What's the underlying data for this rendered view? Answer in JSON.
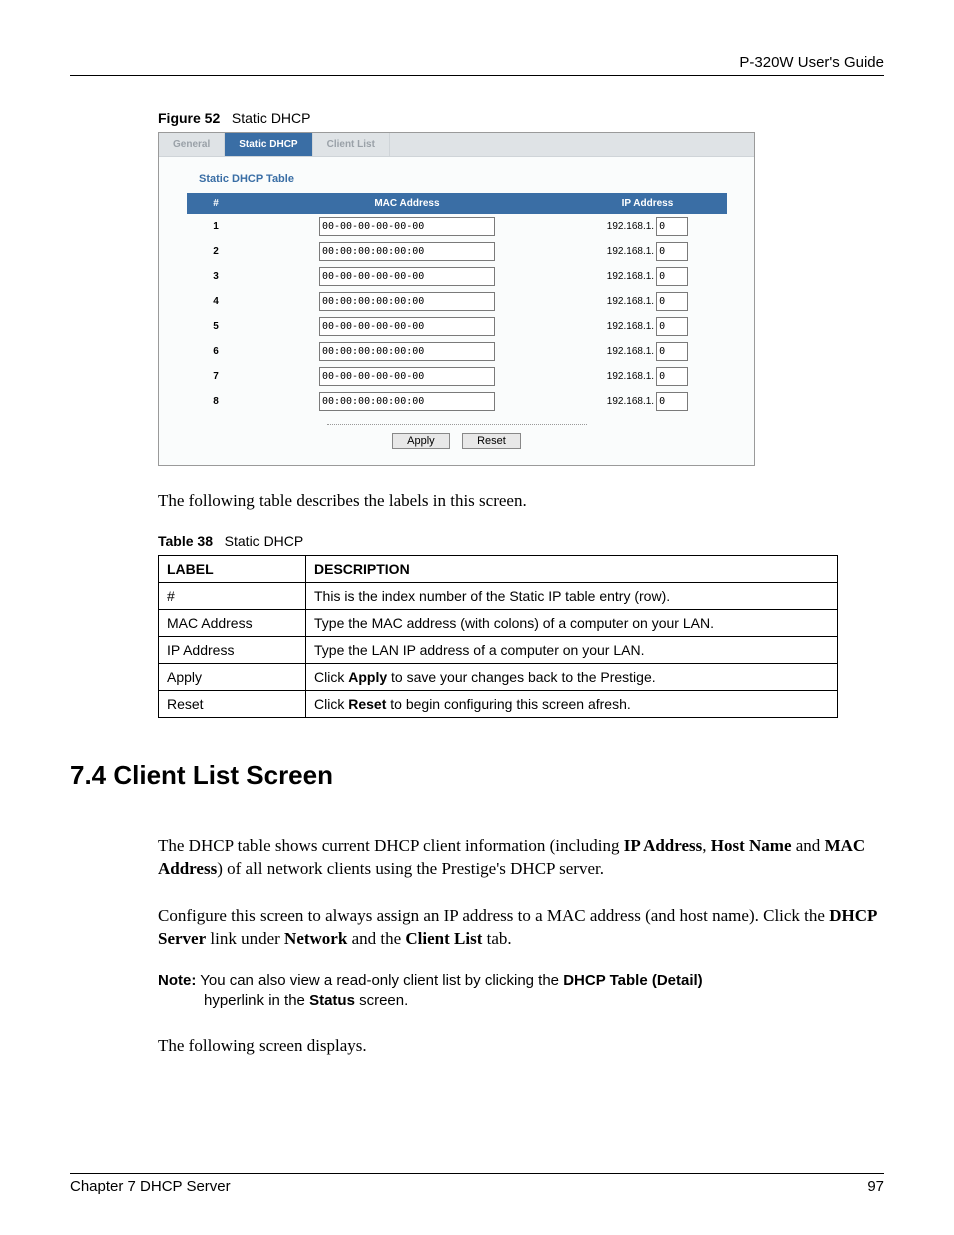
{
  "header": {
    "guide": "P-320W User's Guide"
  },
  "figure": {
    "label": "Figure 52",
    "title": "Static DHCP",
    "tabs": {
      "general": "General",
      "static_dhcp": "Static DHCP",
      "client_list": "Client List"
    },
    "section_title": "Static DHCP Table",
    "columns": {
      "num": "#",
      "mac": "MAC Address",
      "ip": "IP Address"
    },
    "ip_prefix": "192.168.1.",
    "rows": [
      {
        "n": "1",
        "mac": "00-00-00-00-00-00",
        "ip": "0"
      },
      {
        "n": "2",
        "mac": "00:00:00:00:00:00",
        "ip": "0"
      },
      {
        "n": "3",
        "mac": "00-00-00-00-00-00",
        "ip": "0"
      },
      {
        "n": "4",
        "mac": "00:00:00:00:00:00",
        "ip": "0"
      },
      {
        "n": "5",
        "mac": "00-00-00-00-00-00",
        "ip": "0"
      },
      {
        "n": "6",
        "mac": "00:00:00:00:00:00",
        "ip": "0"
      },
      {
        "n": "7",
        "mac": "00-00-00-00-00-00",
        "ip": "0"
      },
      {
        "n": "8",
        "mac": "00:00:00:00:00:00",
        "ip": "0"
      }
    ],
    "buttons": {
      "apply": "Apply",
      "reset": "Reset"
    }
  },
  "para1": "The following table describes the labels in this screen.",
  "table38": {
    "label": "Table 38",
    "title": "Static DHCP",
    "head": {
      "label": "LABEL",
      "desc": "DESCRIPTION"
    },
    "rows": [
      {
        "label": "#",
        "desc": "This is the index number of the Static IP table entry (row)."
      },
      {
        "label": "MAC Address",
        "desc": "Type the MAC address (with colons) of a computer on your LAN."
      },
      {
        "label": "IP Address",
        "desc": "Type the LAN IP address of a computer on your LAN."
      },
      {
        "label": "Apply",
        "desc_pre": "Click ",
        "desc_b": "Apply",
        "desc_post": " to save your changes back to the Prestige."
      },
      {
        "label": "Reset",
        "desc_pre": "Click ",
        "desc_b": "Reset",
        "desc_post": " to begin configuring this screen afresh."
      }
    ]
  },
  "section74": {
    "heading": "7.4  Client List Screen",
    "p1_a": "The DHCP table shows current DHCP client information (including ",
    "p1_b1": "IP Address",
    "p1_b": ", ",
    "p1_b2": "Host Name",
    "p1_c": " and ",
    "p1_b3": "MAC Address",
    "p1_d": ") of all network clients using the Prestige's DHCP server.",
    "p2_a": "Configure this screen to always assign an IP address to a MAC address (and host name). Click the ",
    "p2_b1": "DHCP Server",
    "p2_b": " link under ",
    "p2_b2": "Network",
    "p2_c": " and the ",
    "p2_b3": "Client List",
    "p2_d": " tab.",
    "note_label": "Note:",
    "note_a": " You can also view a read-only client list by clicking the ",
    "note_b1": "DHCP Table (Detail)",
    "note_b": " hyperlink in the ",
    "note_b2": "Status",
    "note_c": " screen.",
    "p3": "The following screen displays."
  },
  "footer": {
    "chapter": "Chapter 7 DHCP Server",
    "page": "97"
  }
}
